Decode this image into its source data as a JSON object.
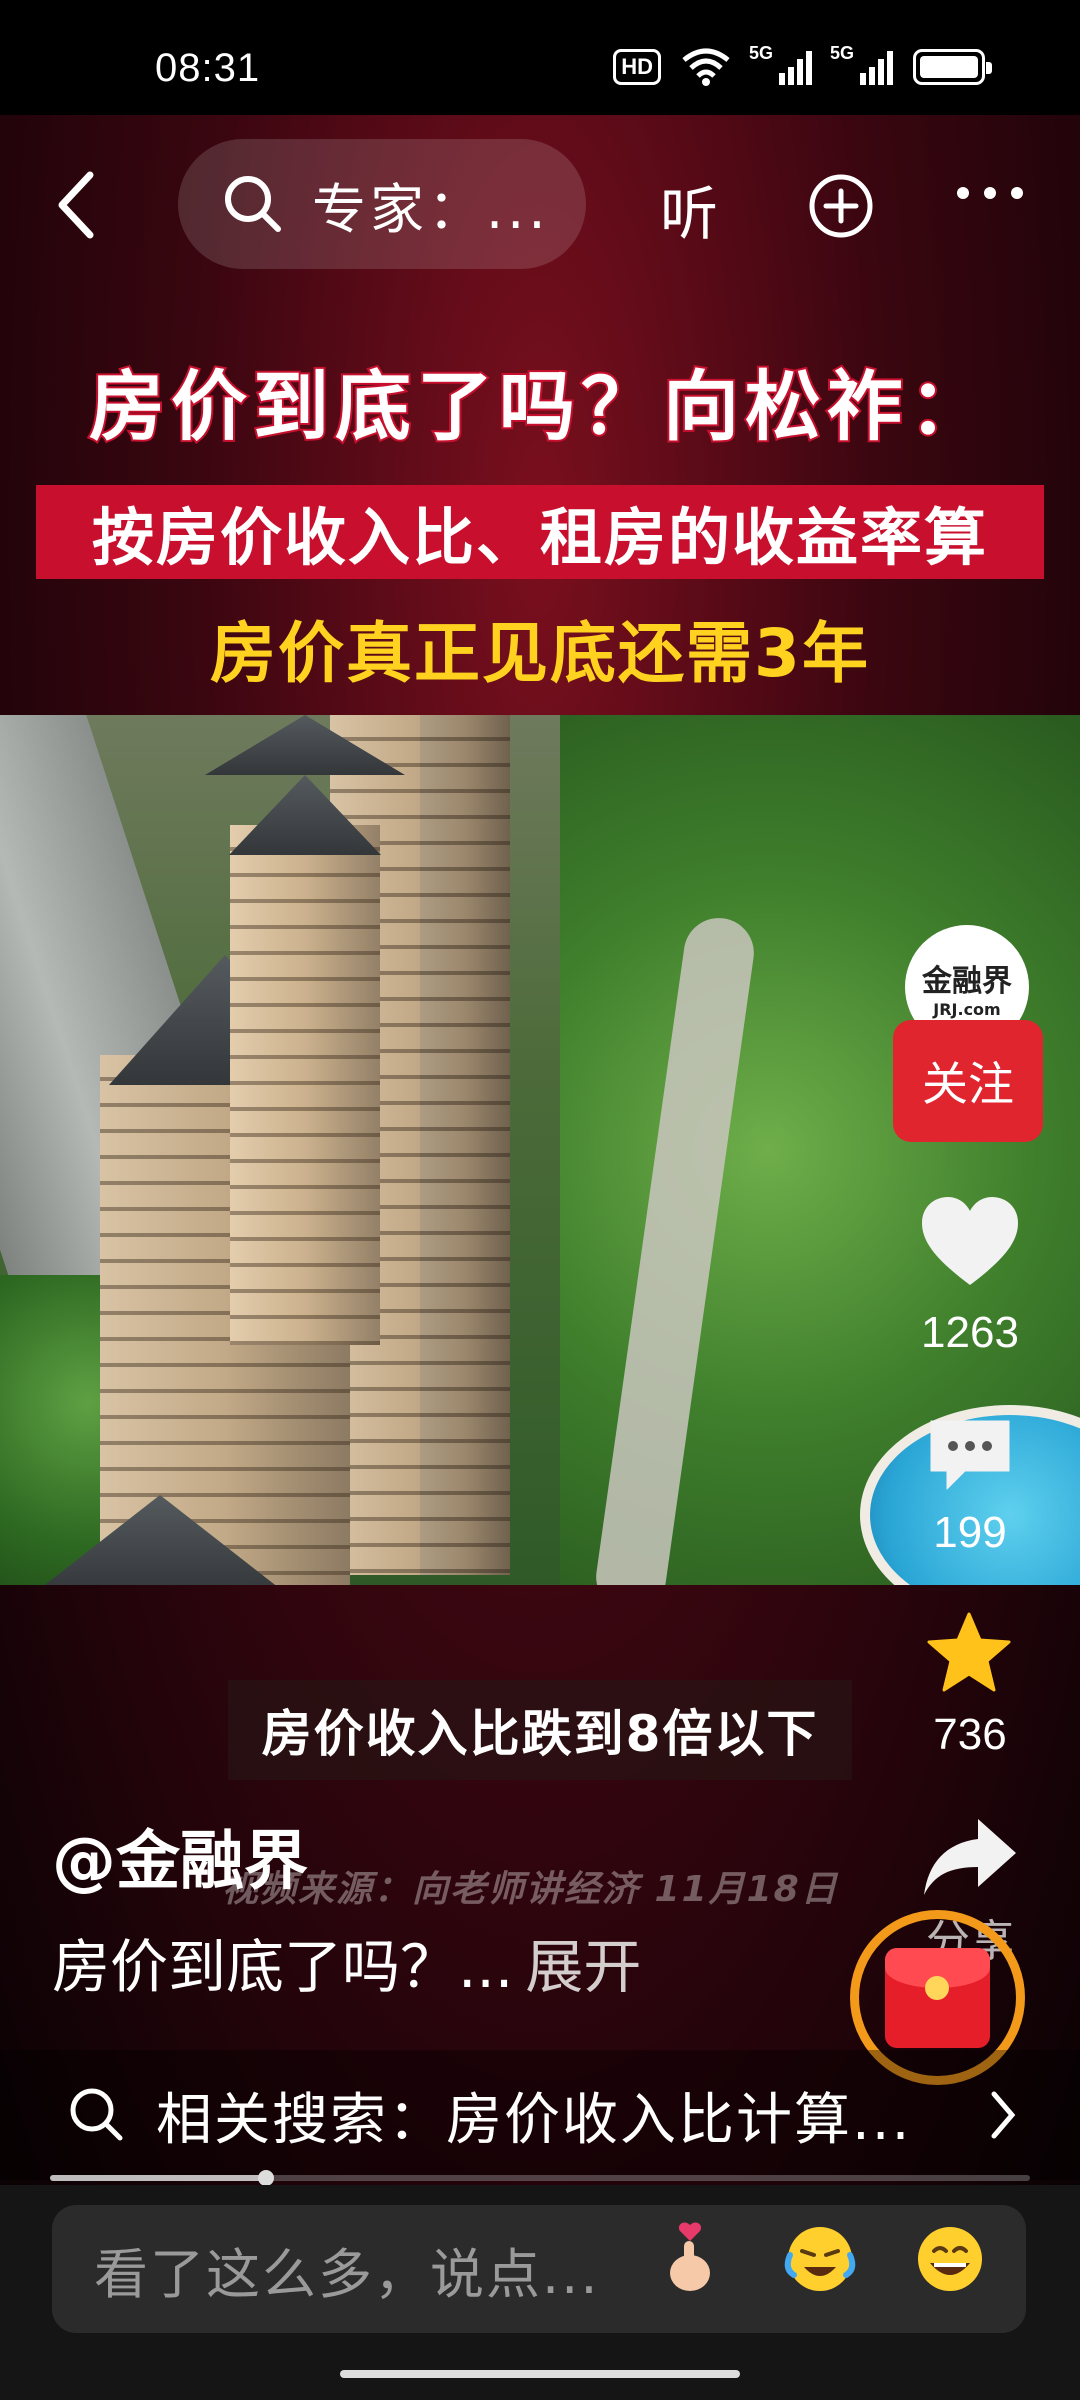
{
  "status_bar": {
    "time": "08:31",
    "hd_label": "HD",
    "network_1": "5G",
    "network_2": "5G"
  },
  "top_nav": {
    "search_query": "专家：...",
    "listen_label": "听"
  },
  "video": {
    "headline_1": "房价到底了吗？向松祚：",
    "headline_2": "按房价收入比、租房的收益率算",
    "headline_3": "房价真正见底还需3年",
    "subtitle": "房价收入比跌到8倍以下",
    "source_watermark": "视频来源：向老师讲经济 11月18日"
  },
  "author": {
    "avatar_text": "金融界",
    "avatar_sub": "JRJ.com",
    "follow_label": "关注",
    "handle": "@金融界"
  },
  "stats": {
    "likes": "1263",
    "comments": "199",
    "favorites": "736",
    "share_label": "分享"
  },
  "description": {
    "text": "房价到底了吗？...",
    "expand_label": "展开"
  },
  "related_search": {
    "label": "相关搜索：房价收入比计算..."
  },
  "playback": {
    "progress": 0.22
  },
  "comment_bar": {
    "placeholder": "看了这么多，说点..."
  },
  "colors": {
    "accent_red": "#e1252e",
    "headline_yellow": "#ffd21f",
    "redpacket_ring": "#f39a1b"
  }
}
